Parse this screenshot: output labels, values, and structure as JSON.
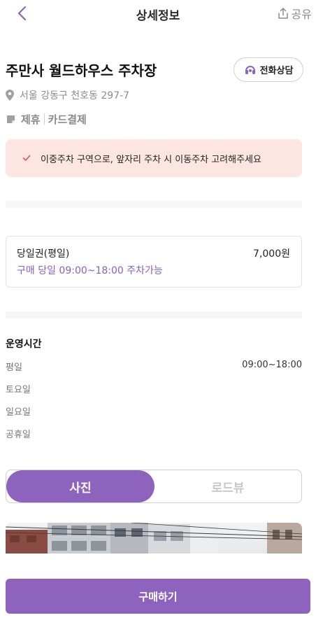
{
  "header": {
    "title": "상세정보",
    "share_label": "공유",
    "back_icon": "chevron-left-icon",
    "share_icon": "share-icon"
  },
  "lot": {
    "name": "주만사 월드하우스 주차장",
    "call_label": "전화상담",
    "call_icon": "headset-icon",
    "address": "서울 강동구 천호동 297-7",
    "address_icon": "location-pin-icon",
    "tags_icon": "tag-icon",
    "tags": [
      "제휴",
      "카드결제"
    ]
  },
  "notice": {
    "icon": "check-icon",
    "text": "이중주차 구역으로, 앞자리 주차 시 이동주차 고려해주세요"
  },
  "ticket": {
    "name": "당일권(평일)",
    "price": "7,000원",
    "description": "구매 당일 09:00~18:00 주차가능"
  },
  "hours": {
    "title": "운영시간",
    "rows": [
      {
        "day": "평일",
        "time": "09:00~18:00"
      },
      {
        "day": "토요일",
        "time": ""
      },
      {
        "day": "일요일",
        "time": ""
      },
      {
        "day": "공휴일",
        "time": ""
      }
    ]
  },
  "media_tabs": {
    "photo_label": "사진",
    "roadview_label": "로드뷰",
    "active": "photo"
  },
  "bottom": {
    "buy_label": "구매하기"
  },
  "colors": {
    "accent": "#8d63bd",
    "notice_bg": "#fde5e1",
    "notice_check": "#d9534f",
    "muted_text": "#8a8a8a"
  }
}
